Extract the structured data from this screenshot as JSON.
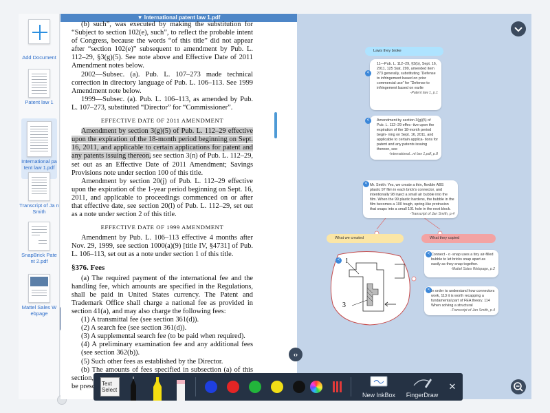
{
  "sidebar": {
    "add_label": "Add Document",
    "items": [
      {
        "label": "Patent law 1"
      },
      {
        "label": "International pa tent law 1.pdf"
      },
      {
        "label": "Transcript of Ja n Smith"
      },
      {
        "label": "SnapBrick Pate nt 2.pdf"
      },
      {
        "label": "Mattel Sales W ebpage"
      }
    ]
  },
  "document": {
    "title": "▼ International patent law 1.pdf",
    "p1": "(b) such”, was executed by making the substitution for “Subject to section 102(e), such”, to reflect the probable intent of Congress, because the words “of this title” did not appear after “section 102(e)” subsequent to amendment by Pub. L. 112–29, §3(g)(5). See note above and Effective Date of 2011 Amendment notes below.",
    "p2": "2002—Subsec. (a). Pub. L. 107–273 made technical correction in directory language of Pub. L. 106–113. See 1999 Amendment note below.",
    "p3": "1999—Subsec. (a). Pub. L. 106–113, as amended by Pub. L. 107–273, substituted “Director” for “Commissioner”.",
    "head1": "EFFECTIVE DATE OF 2011 AMENDMENT",
    "p4_highlight": "Amendment by section 3(g)(5) of Pub. L. 112–29 effective upon the expiration of the 18-month period beginning on Sept. 16, 2011, and applicable to certain applications for patent and any patents issuing thereon,",
    "p4_rest": " see section 3(n) of Pub. L. 112–29, set out as an Effective Date of 2011 Amendment; Savings Provisions note under section 100 of this title.",
    "p5": "Amendment by section 20(j) of Pub. L. 112–29 effective upon the expiration of the 1-year period beginning on Sept. 16, 2011, and applicable to proceedings commenced on or after that effective date, see section 20(l) of Pub. L. 112–29, set out as a note under section 2 of this title.",
    "head2": "EFFECTIVE DATE OF 1999 AMENDMENT",
    "p6": "Amendment by Pub. L. 106–113 effective 4 months after Nov. 29, 1999, see section 1000(a)(9) [title IV, §4731] of Pub. L. 106–113, set out as a note under section 1 of this title.",
    "section": "§376. Fees",
    "p7": "(a) The required payment of the international fee and the handling fee, which amounts are specified in the Regulations, shall be paid in United States currency. The Patent and Trademark Office shall charge a national fee as provided in section 41(a), and may also charge the following fees:",
    "items": [
      "(1) A transmittal fee (see section 361(d)).",
      "(2) A search fee (see section 361(d)).",
      "(3) A supplemental search fee (to be paid when required).",
      "(4) A preliminary examination fee and any additional fees (see section 362(b)).",
      "(5) Such other fees as established by the Director."
    ],
    "p8": "(b) The amounts of fees specified in subsection (a) of this section, except the international fee and the handling fee, shall be prescribed by the Director."
  },
  "map": {
    "tag_laws": "Laws they broke",
    "card1_text": "11—Pub. L. 112–29, §3(b), Sept. 16, 2011, 125 Stat. 299, amended item 273 generally, substituting “Defense to infringement based on prior commercial use” for “Defense to infringement based on earlie",
    "card1_src": "-Patent law 1, p.1",
    "card2_text": "Amendment by section 3(g)(5) of Pub. L. 112–29 effec- tive upon the expiration of the 18-month period begin- ning on Sept. 16, 2011, and applicable to certain applica- tions for patent and any patents issuing thereon, see",
    "card2_src": "-International...nt law 1.pdf, p.8",
    "card3_text": "Mr. Smith: Yes, we create a thin, flexible ABS plastic 97 film in each brick's connector, and intentionally 98 inject a small air bubble into the film. When the 99 plastic hardens, the bubble in the film becomes a 100 tough, spring-like protrusion that snaps into a small 101 hole in the next block.",
    "card3_src": "-Transcript of Jan Smith, p.4",
    "tag_created": "What we created",
    "tag_copied": "What they copied",
    "card4_text": "Connect - o -snap uses a tiny air-filled bubble to let bricks snap apart as easily as they snap together.",
    "card4_src": "-Mattel Sales Webpage, p.2",
    "card5_text": "In order to understand how connectors work, 113 it is worth recapping a fundamental part of FEA theory. 114 When solving a structural",
    "card5_src": "-Transcript of Jan Smith, p.4",
    "fig_label_1": "1",
    "fig_label_3": "3"
  },
  "toolbar": {
    "text_select_label": "Text Select",
    "new_inkbox_label": "New InkBox",
    "finger_draw_label": "FingerDraw",
    "close_label": "✕",
    "colors": [
      "#1e3fe0",
      "#e42525",
      "#22b53b",
      "#f1de16",
      "#111111"
    ]
  },
  "colors": {
    "tag_blue": "#aee3ff",
    "tag_yellow": "#fbe6a6",
    "tag_red": "#f3a3a3",
    "accent": "#3b87d9"
  }
}
